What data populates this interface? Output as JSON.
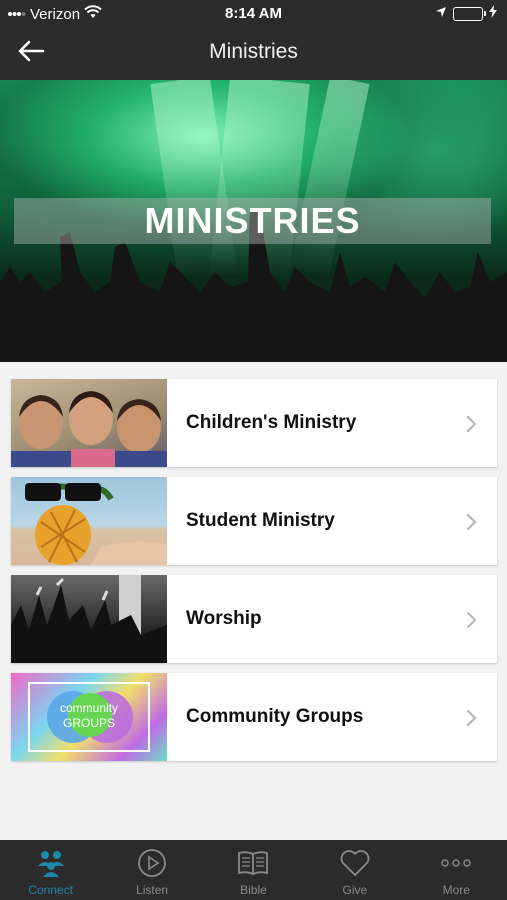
{
  "status_bar": {
    "carrier": "Verizon",
    "time": "8:14 AM",
    "battery_level": 1.0
  },
  "nav": {
    "title": "Ministries"
  },
  "hero": {
    "banner_text": "MINISTRIES"
  },
  "ministries": [
    {
      "label": "Children's Ministry"
    },
    {
      "label": "Student Ministry"
    },
    {
      "label": "Worship"
    },
    {
      "label": "Community Groups",
      "thumb_text_top": "community",
      "thumb_text_bottom": "GROUPS"
    }
  ],
  "tabs": [
    {
      "label": "Connect",
      "icon": "people-icon",
      "active": true
    },
    {
      "label": "Listen",
      "icon": "play-icon"
    },
    {
      "label": "Bible",
      "icon": "book-icon"
    },
    {
      "label": "Give",
      "icon": "heart-icon"
    },
    {
      "label": "More",
      "icon": "more-dots-icon"
    }
  ],
  "colors": {
    "bar": "#2b2b2b",
    "active_tab": "#1e88a8",
    "background": "#f2f2f2"
  }
}
